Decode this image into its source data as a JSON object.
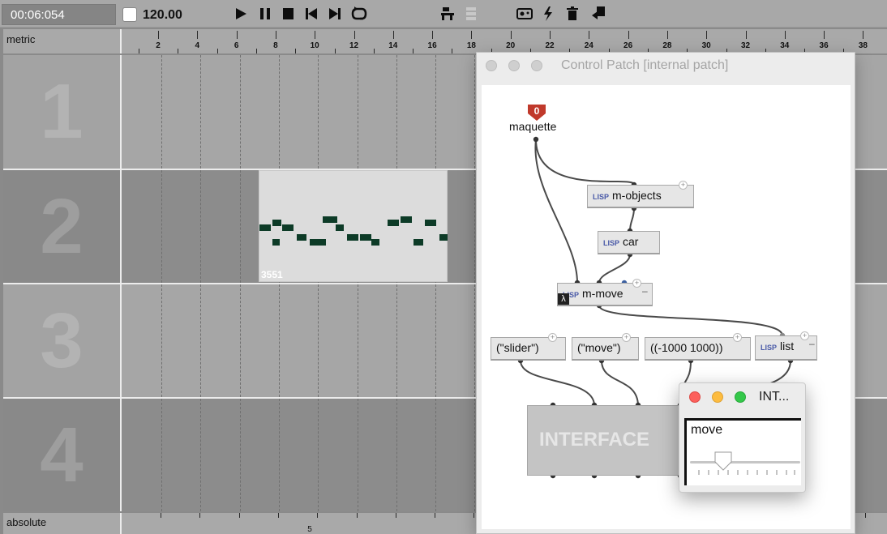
{
  "toolbar": {
    "time": "00:06:054",
    "tempo": "120.00"
  },
  "ruler": {
    "label": "metric",
    "ticks": [
      "2",
      "4",
      "6",
      "8",
      "10",
      "12",
      "14",
      "16",
      "18",
      "20",
      "22",
      "24",
      "26",
      "28",
      "30",
      "32",
      "34",
      "36",
      "38"
    ]
  },
  "tracks": [
    "1",
    "2",
    "3",
    "4"
  ],
  "box": {
    "label": "3551"
  },
  "bottom": {
    "label": "absolute",
    "tick": "5"
  },
  "control_patch": {
    "title": "Control Patch  [internal patch]",
    "maquette_label": "maquette",
    "input_index": "0",
    "nodes": {
      "m_objects": "m-objects",
      "car": "car",
      "m_move": "m-move",
      "slider": "(\"slider\")",
      "move": "(\"move\")",
      "range": "((-1000 1000))",
      "list": "list",
      "interface": "INTERFACE"
    },
    "lisp_tag": "LISP",
    "lambda": "λ"
  },
  "int_window": {
    "title": "INT...",
    "label": "move",
    "slider_value": 0.3
  },
  "colors": {
    "note": "#0d3b27",
    "close": "#fc605c",
    "minimize": "#fdbc40",
    "zoom": "#34c84a",
    "input_marker": "#c0392b"
  }
}
